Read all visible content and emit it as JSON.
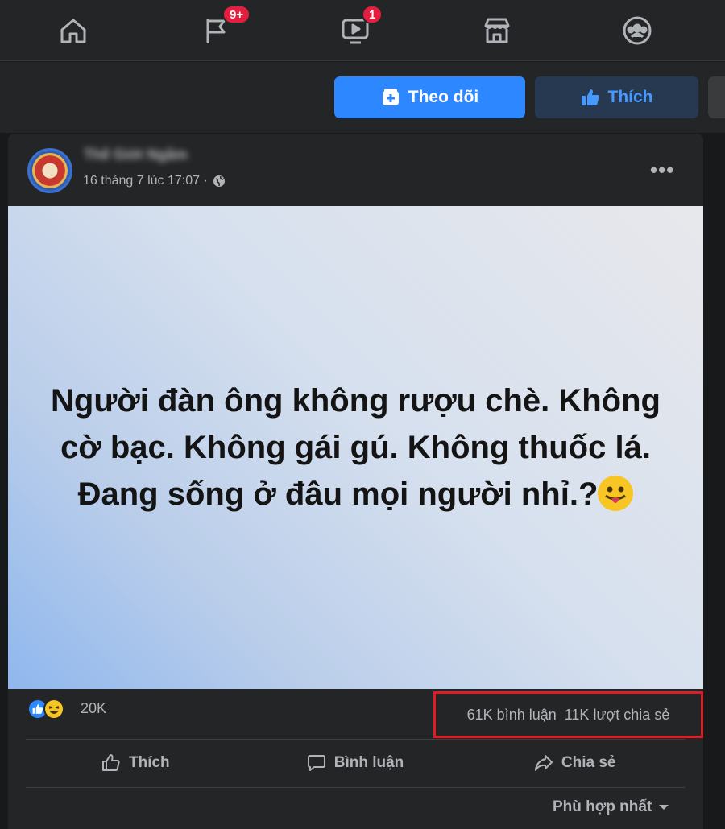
{
  "nav": {
    "items": [
      {
        "icon": "home-icon"
      },
      {
        "icon": "pages-flag-icon",
        "badge": "9+"
      },
      {
        "icon": "watch-video-icon",
        "badge": "1"
      },
      {
        "icon": "marketplace-icon"
      },
      {
        "icon": "groups-icon"
      }
    ]
  },
  "page_actions": {
    "follow_label": "Theo dõi",
    "like_label": "Thích"
  },
  "post": {
    "page_name": "Thế Giới Ngầm",
    "timestamp": "16 tháng 7 lúc 17:07 ·",
    "text": "Người đàn ông không rượu chè. Không cờ bạc. Không gái gú. Không thuốc lá. Đang sống ở đâu mọi người nhỉ.?",
    "reaction_count": "20K",
    "comments": "61K bình luận",
    "shares": "11K lượt chia sẻ",
    "actions": {
      "like": "Thích",
      "comment": "Bình luận",
      "share": "Chia sẻ"
    },
    "sort_label": "Phù hợp nhất"
  },
  "colors": {
    "accent": "#2d88ff",
    "highlight_box": "#e01b24",
    "badge": "#e41e3f"
  }
}
